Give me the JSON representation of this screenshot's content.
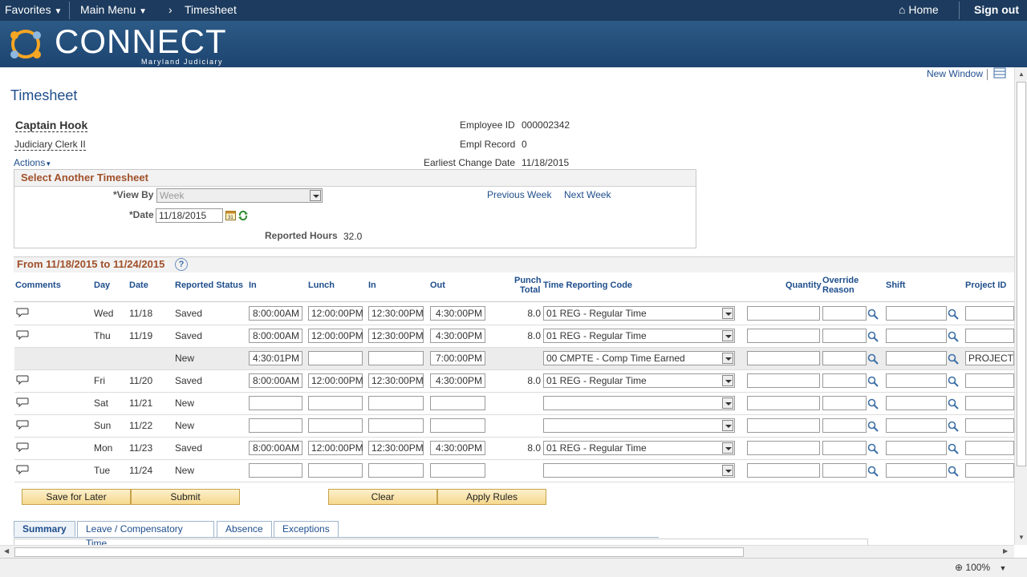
{
  "topnav": {
    "favorites": "Favorites",
    "main_menu": "Main Menu",
    "breadcrumb": "Timesheet",
    "home": "Home",
    "signout": "Sign out"
  },
  "banner": {
    "logo": "CONNECT",
    "sub": "Maryland Judiciary"
  },
  "links": {
    "new_window": "New Window"
  },
  "page_title": "Timesheet",
  "employee": {
    "name": "Captain Hook",
    "title": "Judiciary Clerk II",
    "actions": "Actions",
    "id_label": "Employee ID",
    "id": "000002342",
    "rec_label": "Empl Record",
    "rec": "0",
    "ecd_label": "Earliest Change Date",
    "ecd": "11/18/2015"
  },
  "select": {
    "title": "Select Another Timesheet",
    "view_by_label": "*View By",
    "view_by": "Week",
    "date_label": "*Date",
    "date": "11/18/2015",
    "prev": "Previous Week",
    "next": "Next Week",
    "reported_label": "Reported Hours",
    "reported": "32.0"
  },
  "period": {
    "title": "From 11/18/2015 to 11/24/2015"
  },
  "grid": {
    "headers": {
      "comments": "Comments",
      "day": "Day",
      "date": "Date",
      "status": "Reported Status",
      "in1": "In",
      "lunch": "Lunch",
      "in2": "In",
      "out": "Out",
      "punch1": "Punch",
      "punch2": "Total",
      "trc": "Time Reporting Code",
      "qty": "Quantity",
      "override1": "Override",
      "override2": "Reason",
      "shift": "Shift",
      "project": "Project ID"
    },
    "rows": [
      {
        "day": "Wed",
        "date": "11/18",
        "status": "Saved",
        "in1": "8:00:00AM",
        "lunch": "12:00:00PM",
        "in2": "12:30:00PM",
        "out": "4:30:00PM",
        "total": "8.0",
        "trc": "01 REG - Regular Time",
        "project": ""
      },
      {
        "day": "Thu",
        "date": "11/19",
        "status": "Saved",
        "in1": "8:00:00AM",
        "lunch": "12:00:00PM",
        "in2": "12:30:00PM",
        "out": "4:30:00PM",
        "total": "8.0",
        "trc": "01 REG - Regular Time",
        "project": ""
      },
      {
        "day": "",
        "date": "",
        "status": "New",
        "in1": "4:30:01PM",
        "lunch": "",
        "in2": "",
        "out": "7:00:00PM",
        "total": "",
        "trc": "00 CMPTE - Comp Time Earned",
        "project": "PROJECTS"
      },
      {
        "day": "Fri",
        "date": "11/20",
        "status": "Saved",
        "in1": "8:00:00AM",
        "lunch": "12:00:00PM",
        "in2": "12:30:00PM",
        "out": "4:30:00PM",
        "total": "8.0",
        "trc": "01 REG - Regular Time",
        "project": ""
      },
      {
        "day": "Sat",
        "date": "11/21",
        "status": "New",
        "in1": "",
        "lunch": "",
        "in2": "",
        "out": "",
        "total": "",
        "trc": "",
        "project": ""
      },
      {
        "day": "Sun",
        "date": "11/22",
        "status": "New",
        "in1": "",
        "lunch": "",
        "in2": "",
        "out": "",
        "total": "",
        "trc": "",
        "project": ""
      },
      {
        "day": "Mon",
        "date": "11/23",
        "status": "Saved",
        "in1": "8:00:00AM",
        "lunch": "12:00:00PM",
        "in2": "12:30:00PM",
        "out": "4:30:00PM",
        "total": "8.0",
        "trc": "01 REG - Regular Time",
        "project": ""
      },
      {
        "day": "Tue",
        "date": "11/24",
        "status": "New",
        "in1": "",
        "lunch": "",
        "in2": "",
        "out": "",
        "total": "",
        "trc": "",
        "project": ""
      }
    ]
  },
  "buttons": {
    "save": "Save for Later",
    "submit": "Submit",
    "clear": "Clear",
    "apply": "Apply Rules"
  },
  "tabs": [
    "Summary",
    "Leave / Compensatory Time",
    "Absence",
    "Exceptions"
  ],
  "status": {
    "zoom": "100%"
  }
}
